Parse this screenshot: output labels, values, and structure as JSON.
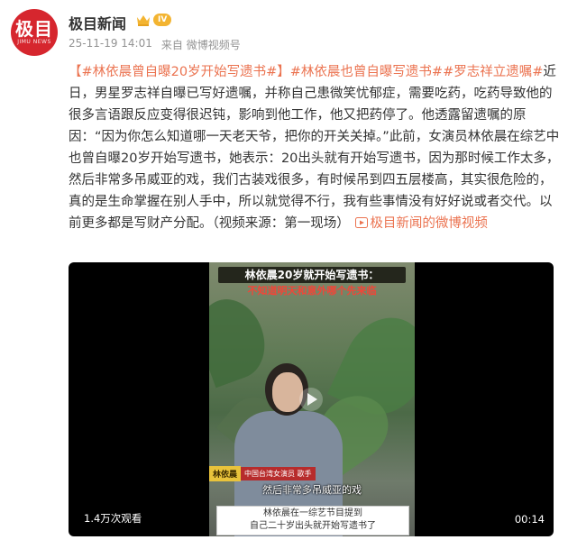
{
  "author": {
    "name": "极目新闻",
    "avatar_main": "极目",
    "avatar_sub": "JIMU NEWS",
    "level_badge": "IV",
    "icons": {
      "vip": "crown-icon"
    },
    "colors": {
      "avatar_bg": "#d6262e",
      "badge": "#f3b431"
    }
  },
  "meta": {
    "time": "25-11-19 14:01",
    "source": "来自 微博视频号"
  },
  "content": {
    "tag1": "【#林依晨曾自曝20岁开始写遗书#】",
    "tag2": "#林依晨也曾自曝写遗书#",
    "tag3": "#罗志祥立遗嘱#",
    "text": "近日，男星罗志祥自曝已写好遗嘱，并称自己患微笑忧郁症，需要吃药，吃药导致他的很多言语跟反应变得很迟钝，影响到他工作，他又把药停了。他透露留遗嘱的原因：“因为你怎么知道哪一天老天爷，把你的开关关掉。”此前，女演员林依晨在综艺中也曾自曝20岁开始写遗书，她表示：20出头就有开始写遗书，因为那时候工作太多，然后非常多吊威亚的戏，我们古装戏很多，有时候吊到四五层楼高，其实很危险的，真的是生命掌握在别人手中，所以就觉得不行，我有些事情没有好好说或者交代。以前更多都是写财产分配。（视频来源：第一现场）",
    "video_link": "极目新闻的微博视频",
    "colors": {
      "link": "#eb7350"
    }
  },
  "video": {
    "title": "林依晨20岁就开始写遗书：",
    "subtitle": "不知道明天和意外哪个先来临",
    "name_card": "林依晨",
    "name_role": "中国台湾女演员 歌手",
    "caption": "然后非常多吊威亚的戏",
    "bottom_line1": "林依晨在一综艺节目提到",
    "bottom_line2": "自己二十岁出头就开始写遗书了",
    "views": "1.4万次观看",
    "duration": "00:14",
    "icons": {
      "play": "play-icon"
    }
  }
}
